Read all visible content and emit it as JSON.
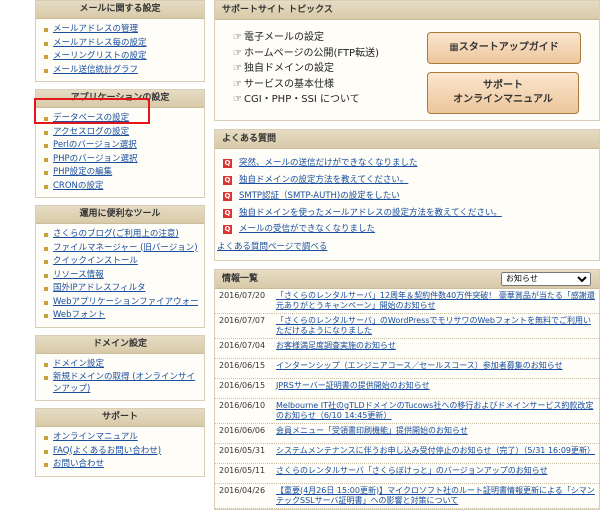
{
  "sidebar": {
    "sections": [
      {
        "title": "メールに関する設定",
        "items": [
          "メールアドレスの管理",
          "メールアドレス毎の設定",
          "メーリングリストの設定",
          "メール送信統計グラフ"
        ]
      },
      {
        "title": "アプリケーションの設定",
        "items": [
          "データベースの設定",
          "アクセスログの設定",
          "Perlのバージョン選択",
          "PHPのバージョン選択",
          "PHP設定の編集",
          "CRONの設定"
        ]
      },
      {
        "title": "運用に便利なツール",
        "items": [
          "さくらのブログ(ご利用上の注意)",
          "ファイルマネージャー (旧バージョン)",
          "クイックインストール",
          "リソース情報",
          "国外IPアドレスフィルタ",
          "Webアプリケーションファイアウォール",
          "Webフォント"
        ]
      },
      {
        "title": "ドメイン設定",
        "items": [
          "ドメイン設定",
          "新規ドメインの取得 (オンラインサインアップ)"
        ]
      },
      {
        "title": "サポート",
        "items": [
          "オンラインマニュアル",
          "FAQ(よくあるお問い合わせ)",
          "お問い合わせ"
        ]
      }
    ]
  },
  "topics": {
    "title": "サポートサイト トピックス",
    "items": [
      "電子メールの設定",
      "ホームページの公開(FTP転送)",
      "独自ドメインの設定",
      "サービスの基本仕様",
      "CGI・PHP・SSI について"
    ],
    "btn_startup": "スタートアップガイド",
    "btn_manual_line1": "サポート",
    "btn_manual_line2": "オンラインマニュアル"
  },
  "faq": {
    "title": "よくある質問",
    "items": [
      "突然、メールの送信だけができなくなりました",
      "独自ドメインの設定方法を教えてください。",
      "SMTP認証（SMTP-AUTH)の設定をしたい",
      "独自ドメインを使ったメールアドレスの設定方法を教えてください。",
      "メールの受信ができなくなりました"
    ],
    "more_link": "よくある質問ページで調べる"
  },
  "info": {
    "title": "情報一覧",
    "filter_selected": "お知らせ",
    "rows": [
      {
        "date": "2016/07/20",
        "text": "「さくらのレンタルサーバ」12周年＆契約件数40万件突破！ 豪華賞品が当たる「感謝還元ありがとうキャンペーン」開始のお知らせ"
      },
      {
        "date": "2016/07/07",
        "text": "「さくらのレンタルサーバ」のWordPressでモリサワのWebフォントを無料でご利用いただけるようになりました"
      },
      {
        "date": "2016/07/04",
        "text": "お客様満足度調査実施のお知らせ"
      },
      {
        "date": "2016/06/15",
        "text": "インターンシップ（エンジニアコース／セールスコース）参加者募集のお知らせ"
      },
      {
        "date": "2016/06/15",
        "text": "JPRSサーバー証明書の提供開始のお知らせ"
      },
      {
        "date": "2016/06/10",
        "text": "Melbourne IT社のgTLDドメインのTucows社への移行およびドメインサービス約款改定のお知らせ（6/10 14:45更新）"
      },
      {
        "date": "2016/06/06",
        "text": "会員メニュー「受領書印刷機能」提供開始のお知らせ"
      },
      {
        "date": "2016/05/31",
        "text": "システムメンテナンスに伴うお申し込み受付停止のお知らせ（完了）（5/31 16:09更新）"
      },
      {
        "date": "2016/05/11",
        "text": "さくらのレンタルサーバ「さくらぼけっと」のバージョンアップのお知らせ"
      },
      {
        "date": "2016/04/26",
        "text": "【重要(4月26日 15:00更新)】マイクロソフト社のルート証明書情報更新による「シマンテックSSLサーバ証明書」への影響と対策について"
      }
    ]
  }
}
